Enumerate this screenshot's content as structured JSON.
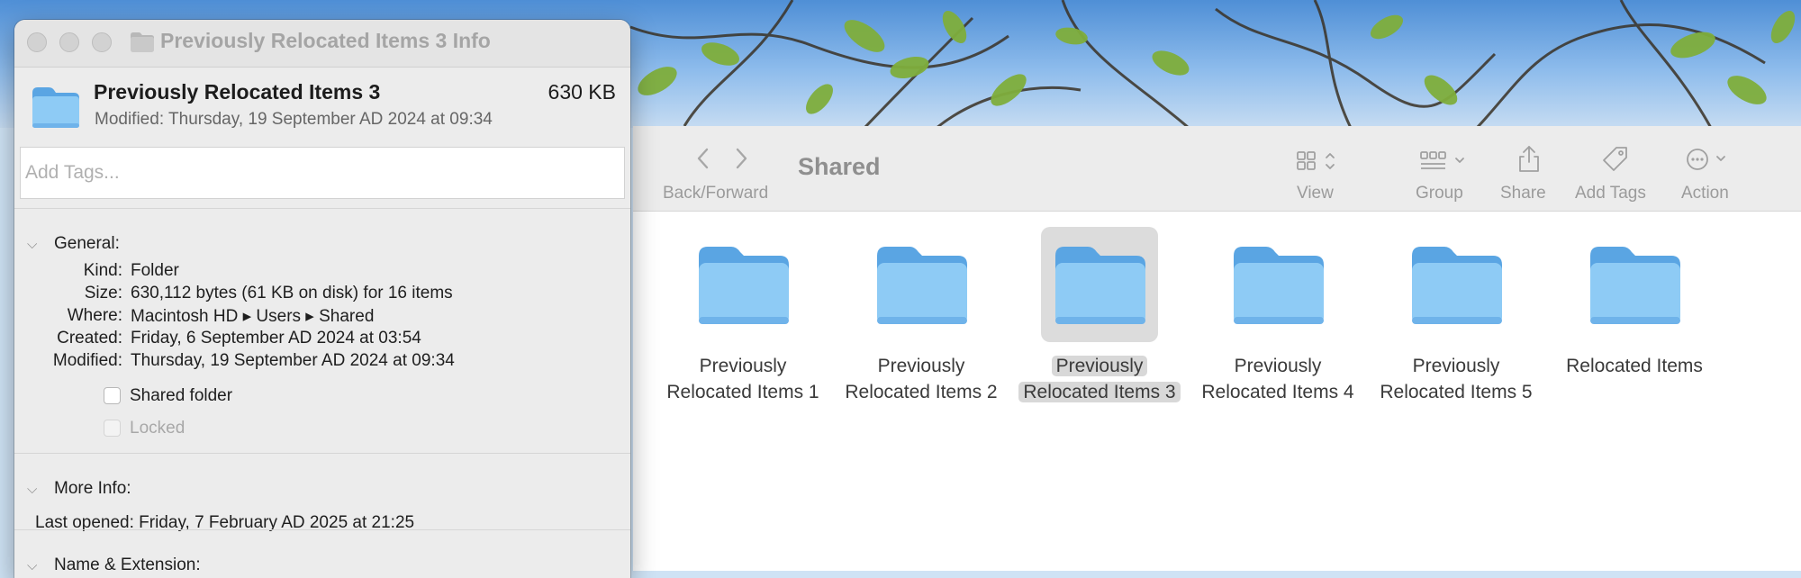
{
  "finder": {
    "title": "Shared",
    "toolbar": {
      "back_forward_label": "Back/Forward",
      "view_label": "View",
      "group_label": "Group",
      "share_label": "Share",
      "add_tags_label": "Add Tags",
      "action_label": "Action"
    },
    "items": [
      {
        "line1": "Previously",
        "line2": "Relocated Items 1"
      },
      {
        "line1": "Previously",
        "line2": "Relocated Items 2"
      },
      {
        "line1": "Previously",
        "line2": "Relocated Items 3",
        "selected": true
      },
      {
        "line1": "Previously",
        "line2": "Relocated Items 4"
      },
      {
        "line1": "Previously",
        "line2": "Relocated Items 5"
      },
      {
        "line1": "Relocated Items",
        "line2": ""
      }
    ]
  },
  "info_window": {
    "title": "Previously Relocated Items 3 Info",
    "name": "Previously Relocated Items 3",
    "size": "630 KB",
    "modified_header": "Modified: Thursday, 19 September AD 2024 at 09:34",
    "tags_placeholder": "Add Tags...",
    "general": {
      "header": "General:",
      "kind_key": "Kind:",
      "kind": "Folder",
      "size_key": "Size:",
      "size": "630,112 bytes (61 KB on disk) for 16 items",
      "where_key": "Where:",
      "where": "Macintosh HD ▸ Users ▸ Shared",
      "created_key": "Created:",
      "created": "Friday, 6 September AD 2024 at 03:54",
      "modified_key": "Modified:",
      "modified": "Thursday, 19 September AD 2024 at 09:34",
      "shared_folder_label": "Shared folder",
      "locked_label": "Locked"
    },
    "more_info": {
      "header": "More Info:",
      "last_opened": "Last opened: Friday, 7 February AD 2025 at 21:25"
    },
    "name_extension": {
      "header": "Name & Extension:"
    }
  },
  "colors": {
    "folder_body": "#8ecbf5",
    "folder_tab": "#5aa5e3",
    "selection": "#dcdcdc"
  }
}
